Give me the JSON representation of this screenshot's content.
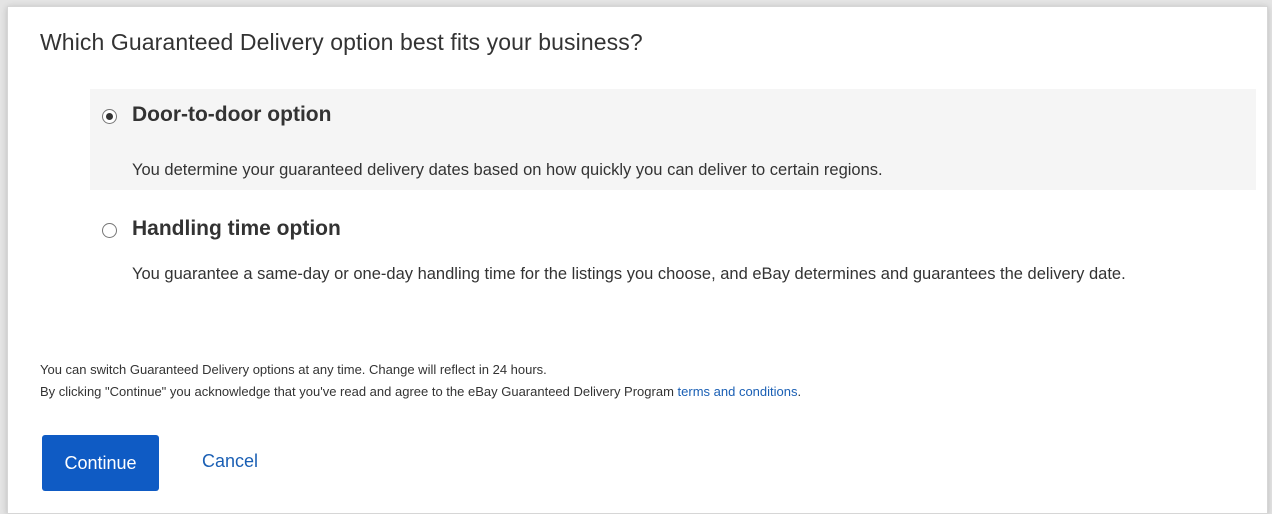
{
  "question": "Which Guaranteed Delivery option best fits your business?",
  "options": [
    {
      "title": "Door-to-door option",
      "description": "You determine your guaranteed delivery dates based on how quickly you can deliver to certain regions.",
      "selected": true
    },
    {
      "title": "Handling time option",
      "description": "You guarantee a same-day or one-day handling time for the listings you choose, and eBay determines and guarantees the delivery date.",
      "selected": false
    }
  ],
  "notes": {
    "line1": "You can switch Guaranteed Delivery options at any time. Change will reflect in 24 hours.",
    "line2_prefix": "By clicking \"Continue\" you acknowledge that you've read and agree to the eBay Guaranteed Delivery Program ",
    "line2_link": "terms and conditions",
    "line2_suffix": "."
  },
  "buttons": {
    "continue_label": "Continue",
    "cancel_label": "Cancel"
  },
  "colors": {
    "primary_button": "#0f5bc4",
    "link": "#1a5fb4",
    "selected_option_bg": "#f5f5f5"
  }
}
